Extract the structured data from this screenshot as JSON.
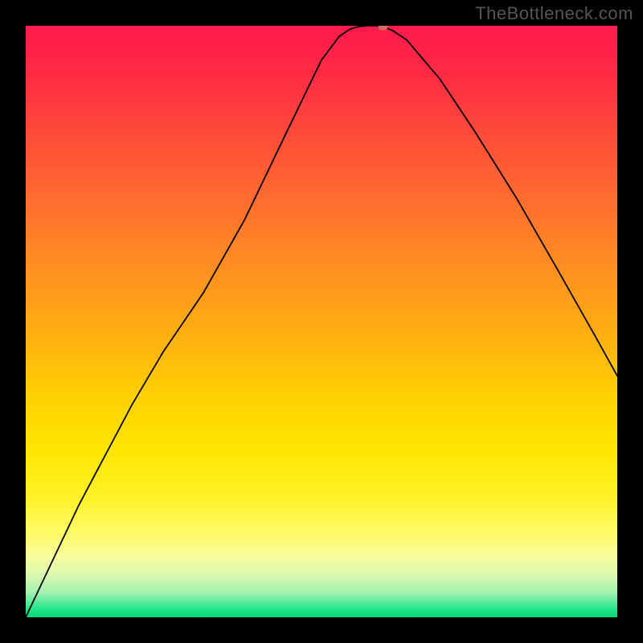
{
  "watermark": "TheBottleneck.com",
  "chart_data": {
    "type": "line",
    "title": "",
    "xlabel": "",
    "ylabel": "",
    "x_range": [
      0,
      1000
    ],
    "y_range": [
      0,
      1000
    ],
    "curve_points": [
      [
        0,
        0
      ],
      [
        90,
        190
      ],
      [
        180,
        360
      ],
      [
        232,
        448
      ],
      [
        300,
        548
      ],
      [
        370,
        672
      ],
      [
        440,
        818
      ],
      [
        500,
        942
      ],
      [
        530,
        982
      ],
      [
        548,
        994
      ],
      [
        560,
        998
      ],
      [
        576,
        1000
      ],
      [
        600,
        1000
      ],
      [
        620,
        992
      ],
      [
        644,
        976
      ],
      [
        700,
        910
      ],
      [
        760,
        820
      ],
      [
        830,
        708
      ],
      [
        900,
        586
      ],
      [
        960,
        480
      ],
      [
        1000,
        408
      ]
    ],
    "marker": {
      "x": 604,
      "y": 998
    },
    "gradient_stops": [
      {
        "pos": 0.0,
        "color": "#ff1a4d"
      },
      {
        "pos": 0.18,
        "color": "#ff4a3a"
      },
      {
        "pos": 0.42,
        "color": "#ff921f"
      },
      {
        "pos": 0.64,
        "color": "#ffd400"
      },
      {
        "pos": 0.8,
        "color": "#fff22a"
      },
      {
        "pos": 0.93,
        "color": "#d8f9b0"
      },
      {
        "pos": 1.0,
        "color": "#00d978"
      }
    ]
  }
}
